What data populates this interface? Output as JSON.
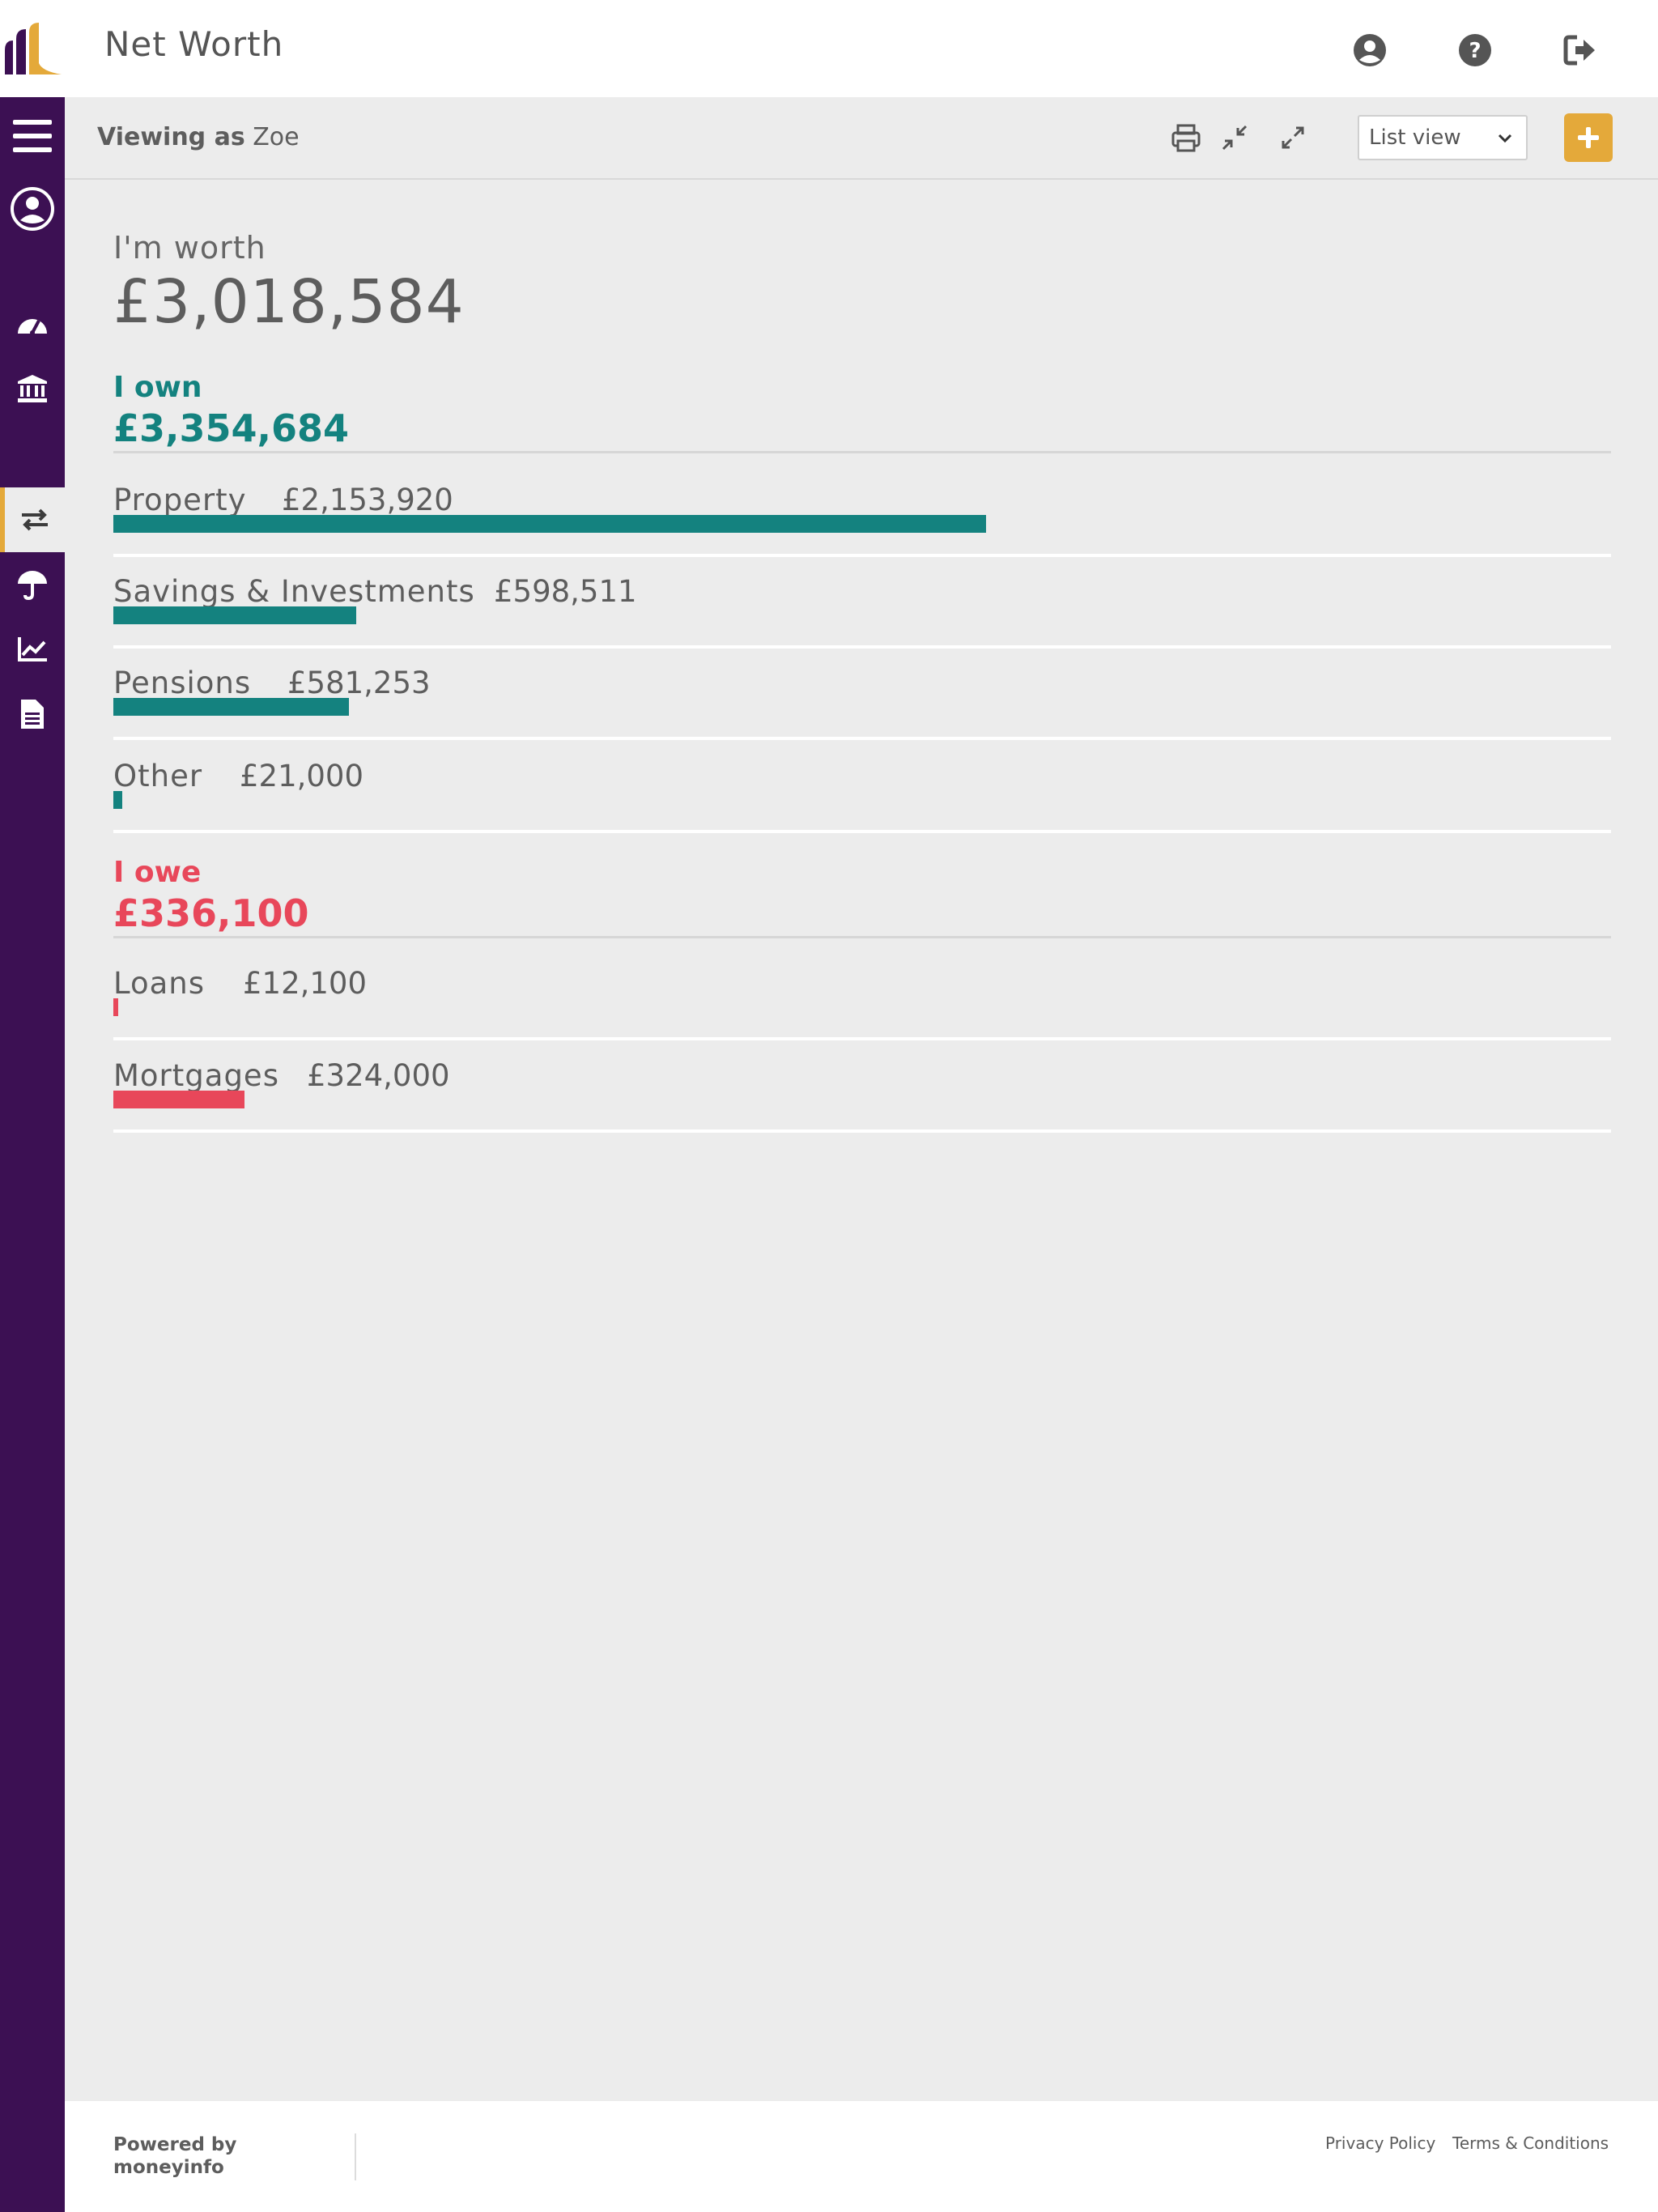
{
  "header": {
    "title": "Net Worth",
    "icons": [
      "user-circle-icon",
      "help-circle-icon",
      "sign-out-icon"
    ]
  },
  "sidebar": {
    "items": [
      {
        "icon": "menu-icon"
      },
      {
        "icon": "user-avatar-icon"
      },
      {
        "icon": "dashboard-gauge-icon"
      },
      {
        "icon": "bank-icon"
      },
      {
        "icon": "transfer-arrows-icon",
        "active": true
      },
      {
        "icon": "umbrella-icon"
      },
      {
        "icon": "line-chart-icon"
      },
      {
        "icon": "document-icon"
      }
    ]
  },
  "toolbar": {
    "viewing_prefix": "Viewing as",
    "viewing_name": "Zoe",
    "view_select": "List view"
  },
  "summary": {
    "worth_label": "I'm worth",
    "worth_value": "£3,018,584"
  },
  "own": {
    "label": "I own",
    "total": "£3,354,684",
    "items": [
      {
        "name": "Property",
        "amount": "£2,153,920",
        "value": 2153920
      },
      {
        "name": "Savings & Investments",
        "amount": "£598,511",
        "value": 598511
      },
      {
        "name": "Pensions",
        "amount": "£581,253",
        "value": 581253
      },
      {
        "name": "Other",
        "amount": "£21,000",
        "value": 21000
      }
    ]
  },
  "owe": {
    "label": "I owe",
    "total": "£336,100",
    "items": [
      {
        "name": "Loans",
        "amount": "£12,100",
        "value": 12100
      },
      {
        "name": "Mortgages",
        "amount": "£324,000",
        "value": 324000
      }
    ]
  },
  "footer": {
    "powered_line1": "Powered by",
    "powered_line2": "moneyinfo",
    "privacy": "Privacy Policy",
    "terms": "Terms & Conditions"
  },
  "colors": {
    "sidebar": "#3c1053",
    "accent": "#e4a93a",
    "own": "#14827f",
    "owe": "#e8475a"
  }
}
